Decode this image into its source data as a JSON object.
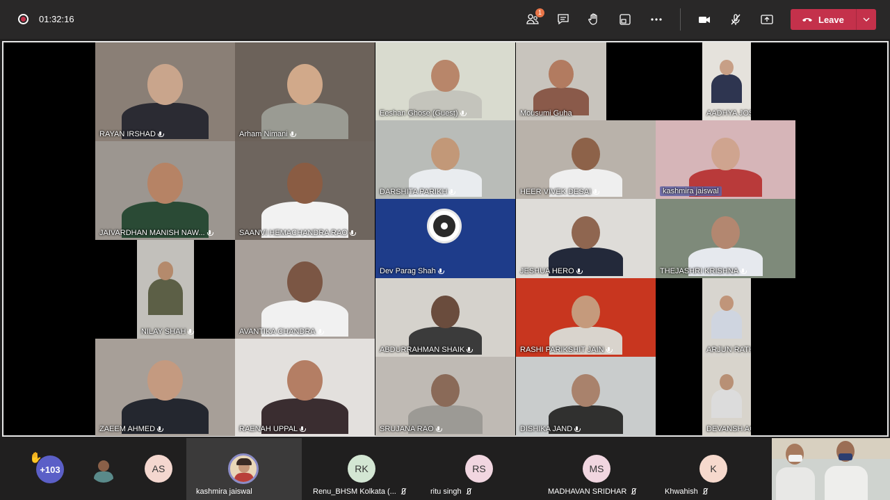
{
  "meeting": {
    "timer": "01:32:16",
    "participants_badge": "1",
    "leave_label": "Leave"
  },
  "tiles": [
    {
      "name": "RAYAN IRSHAD",
      "bg": "#8a7f76",
      "skin": "#c9a58c",
      "cloth": "#2b2b33"
    },
    {
      "name": "Arham Nimani",
      "bg": "#6c625a",
      "skin": "#d1a98a",
      "cloth": "#9a9b93"
    },
    {
      "name": "Eeshan Ghose (Guest)",
      "bg": "#d9dbcf",
      "skin": "#b8866a",
      "cloth": "#c4c4bc"
    },
    {
      "name": "Mousumi Guha",
      "bg": "#c8c4bd",
      "skin": "#b27b60",
      "cloth": "#8a5a4a"
    },
    {
      "name": "AADHYA JOSHI",
      "bg": "#e5e2dc",
      "skin": "#c79f86",
      "cloth": "#2e3550"
    },
    {
      "name": "JAIVARDHAN MANISH NAW...",
      "bg": "#9c9690",
      "skin": "#b68365",
      "cloth": "#2a4a35"
    },
    {
      "name": "SAANVI HEMACHANDRA RAO",
      "bg": "#6e655e",
      "skin": "#8a5c43",
      "cloth": "#f2f2f2"
    },
    {
      "name": "DARSHITA PARIKH",
      "bg": "#b9bcb8",
      "skin": "#c29878",
      "cloth": "#e9ecef"
    },
    {
      "name": "HEER VIVEK DESAI",
      "bg": "#b9b2aa",
      "skin": "#8d6249",
      "cloth": "#efefef"
    },
    {
      "name": "kashmira jaiswal",
      "bg": "#d6b5b8",
      "skin": "#cfa48f",
      "cloth": "#b93a3a"
    },
    {
      "name": "Dev Parag Shah",
      "bg": "#1e3c8a",
      "skin": "",
      "cloth": ""
    },
    {
      "name": "JESHUA HERO",
      "bg": "#dedcd8",
      "skin": "#8f6650",
      "cloth": "#23293a"
    },
    {
      "name": "THEJASHRI KRISHNA",
      "bg": "#7e8a7a",
      "skin": "#b38770",
      "cloth": "#e6e9ee"
    },
    {
      "name": "NILAY SHAH",
      "bg": "#c2c0bb",
      "skin": "#b48a6c",
      "cloth": "#5c5f46"
    },
    {
      "name": "AVANTIKA CHANDRA",
      "bg": "#a8a09a",
      "skin": "#7b5644",
      "cloth": "#f1f1f1"
    },
    {
      "name": "ABDURRAHMAN SHAIK",
      "bg": "#d5d2cc",
      "skin": "#6a4c3d",
      "cloth": "#3b3b3b"
    },
    {
      "name": "RASHI PARIKSHIT JAIN",
      "bg": "#c8361f",
      "skin": "#c59a7c",
      "cloth": "#d9d4cd"
    },
    {
      "name": "ARJUN RATHI",
      "bg": "#d8d5cf",
      "skin": "#c0957a",
      "cloth": "#cfd5e0"
    },
    {
      "name": "ZAEEM AHMED",
      "bg": "#a79f98",
      "skin": "#c49a80",
      "cloth": "#24272f"
    },
    {
      "name": "RAENAH UPPAL",
      "bg": "#e3e0dd",
      "skin": "#b47e64",
      "cloth": "#3a2d30"
    },
    {
      "name": "SRUJANA RAO",
      "bg": "#bfbab4",
      "skin": "#8a6a58",
      "cloth": "#9c9a95"
    },
    {
      "name": "DISHIKA JAND",
      "bg": "#c9cccc",
      "skin": "#a9826c",
      "cloth": "#30302f"
    },
    {
      "name": "DEVANSH AGRAWAL",
      "bg": "#d8d4cc",
      "skin": "#b89075",
      "cloth": "#dcdcdc"
    }
  ],
  "strip": {
    "overflow_count": "+103",
    "participants": [
      {
        "initials": "",
        "name": "",
        "color": "#c9b9a8"
      },
      {
        "initials": "AS",
        "name": "",
        "color": "#f4d7cf"
      },
      {
        "initials": "",
        "name": "kashmira jaiswal",
        "color": "#d9b098"
      },
      {
        "initials": "RK",
        "name": "Renu_BHSM Kolkata (...",
        "color": "#d3e6d3"
      },
      {
        "initials": "RS",
        "name": "ritu singh",
        "color": "#f1d6e0"
      },
      {
        "initials": "MS",
        "name": "MADHAVAN SRIDHAR",
        "color": "#f1d6e0"
      },
      {
        "initials": "K",
        "name": "Khwahish",
        "color": "#f6d9cd"
      }
    ]
  },
  "colors": {
    "accent": "#5b5fc7",
    "leave": "#c4314b",
    "topbar": "#292828"
  }
}
